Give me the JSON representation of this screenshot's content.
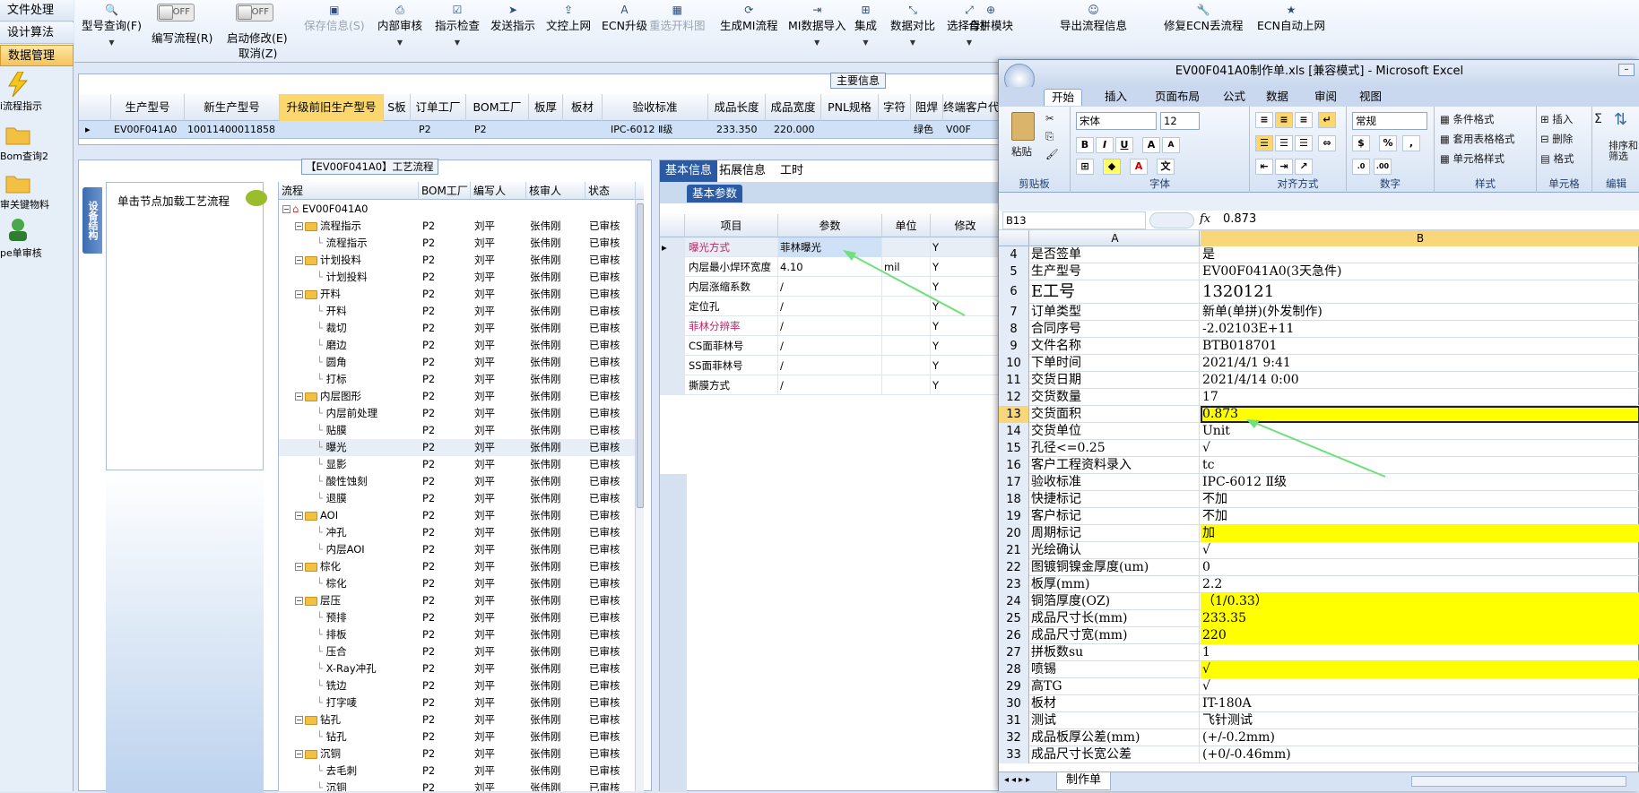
{
  "nav": {
    "tabs": [
      "文件处理",
      "设计算法",
      "数据管理"
    ],
    "items": [
      "i流程指示",
      "Bom查询2",
      "审关键物料",
      "pe单审核"
    ]
  },
  "toolbar": {
    "type_query": "型号查询(F)",
    "edit_flow": "编写流程(R)",
    "edit_flow_toggle": "OFF",
    "start_modify": "启动修改(E)",
    "cancel": "取消(Z)",
    "start_modify_toggle": "OFF",
    "save": "保存信息(S)",
    "inner_review": "内部审核",
    "instr_check": "指示检查",
    "send_instr": "发送指示",
    "doc_online": "文控上网",
    "ecn_upgrade": "ECN升级",
    "reselect_chart": "重选开料图",
    "gen_mi_flow": "生成MI流程",
    "mi_import": "MI数据导入",
    "integrate": "集成",
    "data_compare": "数据对比",
    "select_master": "选择母板",
    "merge_module": "合拼模块",
    "export_flow": "导出流程信息",
    "fix_ecn": "修复ECN丢流程",
    "ecn_auto": "ECN自动上网"
  },
  "main_info": {
    "title": "主要信息",
    "headers": [
      "生产型号",
      "新生产型号",
      "升级前旧生产型号",
      "S板",
      "订单工厂",
      "BOM工厂",
      "板厚",
      "板材",
      "验收标准",
      "成品长度",
      "成品宽度",
      "PNL规格",
      "字符",
      "阻焊",
      "终端客户代码"
    ],
    "row": {
      "model": "EV00F041A0",
      "new_model": "10011400011858",
      "order_factory": "P2",
      "bom_factory": "P2",
      "standard": "IPC-6012 Ⅱ级",
      "length": "233.350",
      "width": "220.000",
      "solder": "绿色",
      "client": "V00F"
    }
  },
  "process": {
    "title": "【EV00F041A0】工艺流程",
    "vert_tab": "设备结构",
    "node_hint": "单击节点加载工艺流程",
    "headers": [
      "流程",
      "BOM工厂",
      "编写人",
      "核审人",
      "状态"
    ],
    "root": "EV00F041A0",
    "rows": [
      {
        "name": "流程指示",
        "lvl": 1,
        "f": "P2",
        "w": "刘平",
        "r": "张伟刚",
        "s": "已审核"
      },
      {
        "name": "流程指示",
        "lvl": 2,
        "f": "P2",
        "w": "刘平",
        "r": "张伟刚",
        "s": "已审核"
      },
      {
        "name": "计划投料",
        "lvl": 1,
        "f": "P2",
        "w": "刘平",
        "r": "张伟刚",
        "s": "已审核"
      },
      {
        "name": "计划投料",
        "lvl": 2,
        "f": "P2",
        "w": "刘平",
        "r": "张伟刚",
        "s": "已审核"
      },
      {
        "name": "开料",
        "lvl": 1,
        "f": "P2",
        "w": "刘平",
        "r": "张伟刚",
        "s": "已审核"
      },
      {
        "name": "开料",
        "lvl": 2,
        "f": "P2",
        "w": "刘平",
        "r": "张伟刚",
        "s": "已审核"
      },
      {
        "name": "裁切",
        "lvl": 2,
        "f": "P2",
        "w": "刘平",
        "r": "张伟刚",
        "s": "已审核"
      },
      {
        "name": "磨边",
        "lvl": 2,
        "f": "P2",
        "w": "刘平",
        "r": "张伟刚",
        "s": "已审核"
      },
      {
        "name": "圆角",
        "lvl": 2,
        "f": "P2",
        "w": "刘平",
        "r": "张伟刚",
        "s": "已审核"
      },
      {
        "name": "打标",
        "lvl": 2,
        "f": "P2",
        "w": "刘平",
        "r": "张伟刚",
        "s": "已审核"
      },
      {
        "name": "内层图形",
        "lvl": 1,
        "f": "P2",
        "w": "刘平",
        "r": "张伟刚",
        "s": "已审核"
      },
      {
        "name": "内层前处理",
        "lvl": 2,
        "f": "P2",
        "w": "刘平",
        "r": "张伟刚",
        "s": "已审核"
      },
      {
        "name": "贴膜",
        "lvl": 2,
        "f": "P2",
        "w": "刘平",
        "r": "张伟刚",
        "s": "已审核"
      },
      {
        "name": "曝光",
        "lvl": 2,
        "f": "P2",
        "w": "刘平",
        "r": "张伟刚",
        "s": "已审核",
        "sel": true
      },
      {
        "name": "显影",
        "lvl": 2,
        "f": "P2",
        "w": "刘平",
        "r": "张伟刚",
        "s": "已审核"
      },
      {
        "name": "酸性蚀刻",
        "lvl": 2,
        "f": "P2",
        "w": "刘平",
        "r": "张伟刚",
        "s": "已审核"
      },
      {
        "name": "退膜",
        "lvl": 2,
        "f": "P2",
        "w": "刘平",
        "r": "张伟刚",
        "s": "已审核"
      },
      {
        "name": "AOI",
        "lvl": 1,
        "f": "P2",
        "w": "刘平",
        "r": "张伟刚",
        "s": "已审核"
      },
      {
        "name": "冲孔",
        "lvl": 2,
        "f": "P2",
        "w": "刘平",
        "r": "张伟刚",
        "s": "已审核"
      },
      {
        "name": "内层AOI",
        "lvl": 2,
        "f": "P2",
        "w": "刘平",
        "r": "张伟刚",
        "s": "已审核"
      },
      {
        "name": "棕化",
        "lvl": 1,
        "f": "P2",
        "w": "刘平",
        "r": "张伟刚",
        "s": "已审核"
      },
      {
        "name": "棕化",
        "lvl": 2,
        "f": "P2",
        "w": "刘平",
        "r": "张伟刚",
        "s": "已审核"
      },
      {
        "name": "层压",
        "lvl": 1,
        "f": "P2",
        "w": "刘平",
        "r": "张伟刚",
        "s": "已审核"
      },
      {
        "name": "预排",
        "lvl": 2,
        "f": "P2",
        "w": "刘平",
        "r": "张伟刚",
        "s": "已审核"
      },
      {
        "name": "排板",
        "lvl": 2,
        "f": "P2",
        "w": "刘平",
        "r": "张伟刚",
        "s": "已审核"
      },
      {
        "name": "压合",
        "lvl": 2,
        "f": "P2",
        "w": "刘平",
        "r": "张伟刚",
        "s": "已审核"
      },
      {
        "name": "X-Ray冲孔",
        "lvl": 2,
        "f": "P2",
        "w": "刘平",
        "r": "张伟刚",
        "s": "已审核"
      },
      {
        "name": "铣边",
        "lvl": 2,
        "f": "P2",
        "w": "刘平",
        "r": "张伟刚",
        "s": "已审核"
      },
      {
        "name": "打字唛",
        "lvl": 2,
        "f": "P2",
        "w": "刘平",
        "r": "张伟刚",
        "s": "已审核"
      },
      {
        "name": "钻孔",
        "lvl": 1,
        "f": "P2",
        "w": "刘平",
        "r": "张伟刚",
        "s": "已审核"
      },
      {
        "name": "钻孔",
        "lvl": 2,
        "f": "P2",
        "w": "刘平",
        "r": "张伟刚",
        "s": "已审核"
      },
      {
        "name": "沉铜",
        "lvl": 1,
        "f": "P2",
        "w": "刘平",
        "r": "张伟刚",
        "s": "已审核"
      },
      {
        "name": "去毛刺",
        "lvl": 2,
        "f": "P2",
        "w": "刘平",
        "r": "张伟刚",
        "s": "已审核"
      },
      {
        "name": "沉铜",
        "lvl": 2,
        "f": "P2",
        "w": "刘平",
        "r": "张伟刚",
        "s": "已审核"
      }
    ]
  },
  "params": {
    "tabs": [
      "基本信息",
      "拓展信息",
      "工时"
    ],
    "sub_tab": "基本参数",
    "headers": [
      "项目",
      "参数",
      "单位",
      "修改"
    ],
    "rows": [
      {
        "item": "曝光方式",
        "val": "菲林曝光",
        "unit": "",
        "mod": "Y",
        "pink": true
      },
      {
        "item": "内层最小焊环宽度",
        "val": "4.10",
        "unit": "mil",
        "mod": "Y"
      },
      {
        "item": "内层涨缩系数",
        "val": "/",
        "unit": "",
        "mod": "Y"
      },
      {
        "item": "定位孔",
        "val": "/",
        "unit": "",
        "mod": "Y"
      },
      {
        "item": "菲林分辨率",
        "val": "/",
        "unit": "",
        "mod": "Y",
        "pink": true
      },
      {
        "item": "CS面菲林号",
        "val": "/",
        "unit": "",
        "mod": "Y"
      },
      {
        "item": "SS面菲林号",
        "val": "/",
        "unit": "",
        "mod": "Y"
      },
      {
        "item": "撕膜方式",
        "val": "/",
        "unit": "",
        "mod": "Y"
      }
    ]
  },
  "excel": {
    "title": "EV00F041A0制作单.xls  [兼容模式] - Microsoft Excel",
    "tabs": [
      "开始",
      "插入",
      "页面布局",
      "公式",
      "数据",
      "审阅",
      "视图"
    ],
    "ribbon": {
      "paste": "粘贴",
      "clipboard": "剪贴板",
      "font_name": "宋体",
      "font_size": "12",
      "font": "字体",
      "align": "对齐方式",
      "num_format": "常规",
      "number": "数字",
      "cond_format": "条件格式",
      "table_format": "套用表格格式",
      "cell_style": "单元格样式",
      "style": "样式",
      "insert": "插入",
      "delete": "删除",
      "format": "格式",
      "cells": "单元格",
      "sort_filter": "排序和筛选",
      "edit": "编辑"
    },
    "namebox": "B13",
    "fx": "fx",
    "formula": "0.873",
    "col_a": "A",
    "col_b": "B",
    "rows": [
      {
        "n": "4",
        "a": "是否签单",
        "b": "是"
      },
      {
        "n": "5",
        "a": "生产型号",
        "b": "EV00F041A0(3天急件)"
      },
      {
        "n": "6",
        "a": "E工号",
        "b": "1320121",
        "big": true
      },
      {
        "n": "7",
        "a": "订单类型",
        "b": "新单(单拼)(外发制作)"
      },
      {
        "n": "8",
        "a": "合同序号",
        "b": "-2.02103E+11"
      },
      {
        "n": "9",
        "a": "文件名称",
        "b": "BTB018701"
      },
      {
        "n": "10",
        "a": "下单时间",
        "b": "2021/4/1 9:41"
      },
      {
        "n": "11",
        "a": "交货日期",
        "b": "2021/4/14 0:00"
      },
      {
        "n": "12",
        "a": "交货数量",
        "b": "17"
      },
      {
        "n": "13",
        "a": "交货面积",
        "b": "0.873",
        "yel": true,
        "sel": true
      },
      {
        "n": "14",
        "a": "交货单位",
        "b": "Unit"
      },
      {
        "n": "15",
        "a": "孔径<=0.25",
        "b": "√"
      },
      {
        "n": "16",
        "a": "客户工程资料录入",
        "b": "tc"
      },
      {
        "n": "17",
        "a": "验收标准",
        "b": "IPC-6012 Ⅱ级"
      },
      {
        "n": "18",
        "a": "快捷标记",
        "b": "不加"
      },
      {
        "n": "19",
        "a": "客户标记",
        "b": "不加"
      },
      {
        "n": "20",
        "a": "周期标记",
        "b": "加",
        "yel": true
      },
      {
        "n": "21",
        "a": "光绘确认",
        "b": "√"
      },
      {
        "n": "22",
        "a": "图镀铜镍金厚度(um)",
        "b": "0"
      },
      {
        "n": "23",
        "a": "板厚(mm)",
        "b": "2.2"
      },
      {
        "n": "24",
        "a": "铜箔厚度(OZ)",
        "b": "（1/0.33）",
        "yel": true
      },
      {
        "n": "25",
        "a": "成品尺寸长(mm)",
        "b": "233.35",
        "yel": true
      },
      {
        "n": "26",
        "a": "成品尺寸宽(mm)",
        "b": "220",
        "yel": true
      },
      {
        "n": "27",
        "a": "拼板数su",
        "b": "1"
      },
      {
        "n": "28",
        "a": "喷锡",
        "b": "√",
        "yel": true
      },
      {
        "n": "29",
        "a": "高TG",
        "b": "√"
      },
      {
        "n": "30",
        "a": "板材",
        "b": "IT-180A"
      },
      {
        "n": "31",
        "a": "测试",
        "b": "飞针测试"
      },
      {
        "n": "32",
        "a": "成品板厚公差(mm)",
        "b": "(+/-0.2mm)"
      },
      {
        "n": "33",
        "a": "成品尺寸长宽公差",
        "b": "(+0/-0.46mm)"
      }
    ],
    "sheet_tab": "制作单"
  },
  "colors": {
    "accent": "#2b5aa5",
    "highlight": "#ffff00",
    "arrow": "#6fe07a",
    "header_hl": "#fbd76e"
  }
}
